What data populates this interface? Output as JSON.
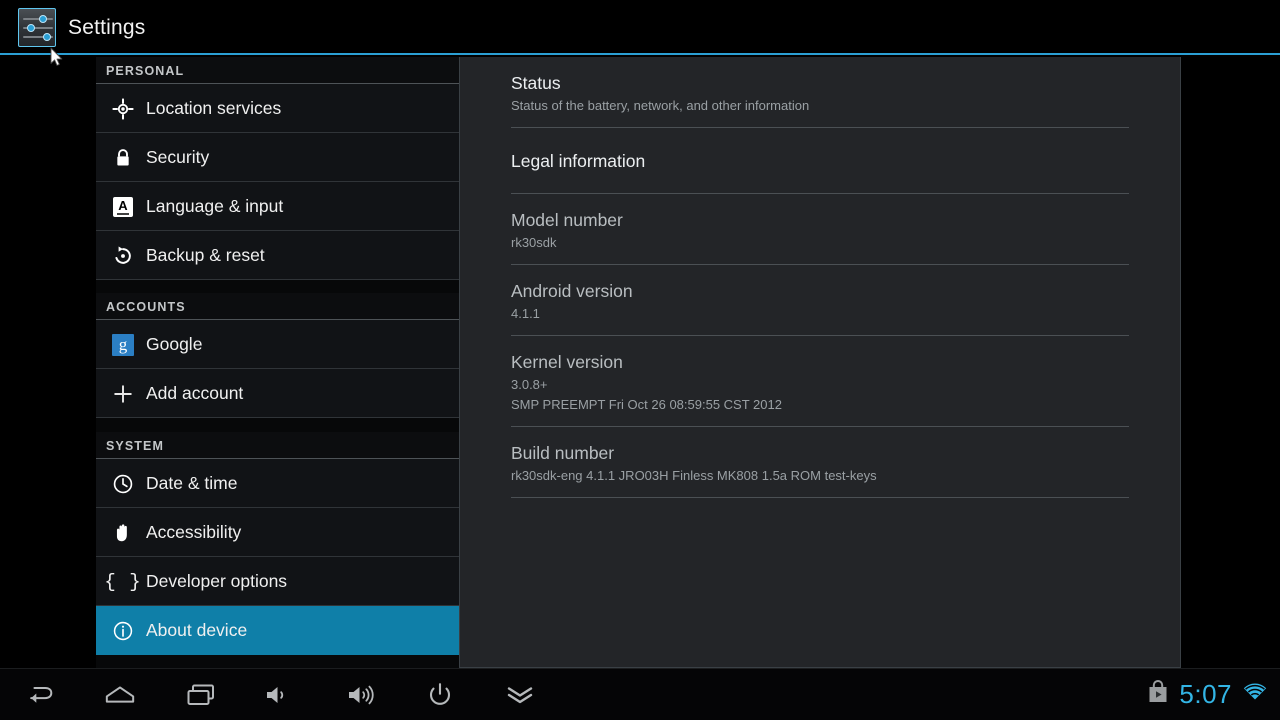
{
  "app": {
    "title": "Settings",
    "icon": "settings-sliders-icon",
    "accent_color": "#2b9fd4"
  },
  "sidebar": {
    "groups": [
      {
        "header": "PERSONAL",
        "items": [
          {
            "label": "Location services",
            "icon": "location-crosshair-icon",
            "selected": false
          },
          {
            "label": "Security",
            "icon": "lock-icon",
            "selected": false
          },
          {
            "label": "Language & input",
            "icon": "language-keyboard-icon",
            "selected": false
          },
          {
            "label": "Backup & reset",
            "icon": "backup-restore-icon",
            "selected": false
          }
        ]
      },
      {
        "header": "ACCOUNTS",
        "items": [
          {
            "label": "Google",
            "icon": "google-icon",
            "selected": false
          },
          {
            "label": "Add account",
            "icon": "plus-icon",
            "selected": false
          }
        ]
      },
      {
        "header": "SYSTEM",
        "items": [
          {
            "label": "Date & time",
            "icon": "clock-icon",
            "selected": false
          },
          {
            "label": "Accessibility",
            "icon": "hand-icon",
            "selected": false
          },
          {
            "label": "Developer options",
            "icon": "curly-braces-icon",
            "selected": false
          },
          {
            "label": "About device",
            "icon": "info-circle-icon",
            "selected": true
          }
        ]
      }
    ],
    "selected_color": "#0f7fa8"
  },
  "content": {
    "items": [
      {
        "title": "Status",
        "summary": "Status of the battery, network, and other information",
        "clickable": true
      },
      {
        "title": "Legal information",
        "summary": "",
        "clickable": true
      },
      {
        "title": "Model number",
        "summary": "rk30sdk",
        "clickable": false
      },
      {
        "title": "Android version",
        "summary": "4.1.1",
        "clickable": false
      },
      {
        "title": "Kernel version",
        "summary": "3.0.8+",
        "summary2": "SMP PREEMPT Fri Oct 26 08:59:55 CST 2012",
        "clickable": false
      },
      {
        "title": "Build number",
        "summary": "rk30sdk-eng 4.1.1 JRO03H Finless MK808 1.5a ROM test-keys",
        "clickable": false
      }
    ]
  },
  "navbar": {
    "buttons": [
      {
        "name": "back-icon",
        "label": "Back"
      },
      {
        "name": "home-icon",
        "label": "Home"
      },
      {
        "name": "recents-icon",
        "label": "Recent apps"
      },
      {
        "name": "volume-down-icon",
        "label": "Volume down"
      },
      {
        "name": "volume-up-icon",
        "label": "Volume up"
      },
      {
        "name": "power-icon",
        "label": "Power"
      },
      {
        "name": "hide-bar-icon",
        "label": "Hide navigation bar"
      }
    ],
    "status": {
      "play-store-icon": "Play Store",
      "clock": "5:07",
      "wifi-icon": "Wi-Fi connected",
      "clock_color": "#33b5e5"
    }
  }
}
